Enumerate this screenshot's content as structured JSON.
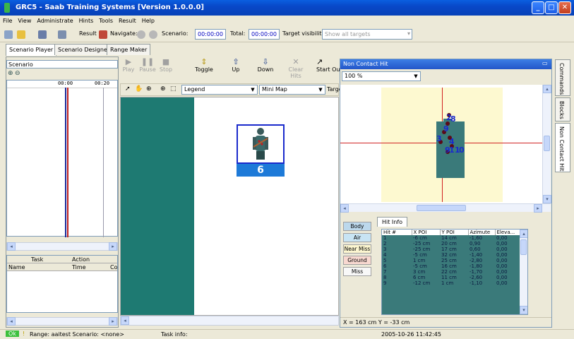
{
  "window": {
    "title": "GRC5 - Saab Training Systems  [Version 1.0.0.0]"
  },
  "menu": [
    "File",
    "View",
    "Administrate",
    "Hints",
    "Tools",
    "Result",
    "Help"
  ],
  "toolbar": {
    "result_label": "Result",
    "navigate_label": "Navigate:",
    "scenario_label": "Scenario:",
    "scenario_time": "00:00:00",
    "total_label": "Total:",
    "total_time": "00:00:00",
    "target_visibility_label": "Target visibility",
    "target_visibility_value": "Show all targets"
  },
  "tabs": [
    "Scenario Player",
    "Scenario Designer",
    "Range Maker"
  ],
  "left_panel": {
    "title": "Scenario",
    "time_start": "00:00",
    "time_end": "00:20",
    "task_columns": [
      "Task",
      "Action"
    ],
    "list_columns": [
      "Name",
      "Time",
      "Co"
    ]
  },
  "controls": {
    "play": "Play",
    "pause": "Pause",
    "stop": "Stop",
    "toggle": "Toggle",
    "up": "Up",
    "down": "Down",
    "clear_hits": "Clear Hits",
    "start_out": "Start Ou"
  },
  "view_toolbar": {
    "legend": "Legend",
    "minimap": "Mini Map",
    "target": "Targe"
  },
  "target": {
    "number": "6"
  },
  "non_contact": {
    "title": "Non Contact Hit",
    "zoom": "100 %",
    "hit_labels": [
      "2",
      "8",
      "3",
      "9",
      "1",
      "4",
      "9",
      "1",
      "0"
    ],
    "coords": "X = 163 cm   Y = -33 cm"
  },
  "hit_info": {
    "tab": "Hit Info",
    "categories": [
      "Body",
      "Air",
      "Near Miss",
      "Ground",
      "Miss"
    ],
    "columns": [
      "Hit #",
      "X POI",
      "Y POI",
      "Azimute",
      "Eleva..."
    ],
    "rows": [
      [
        "1",
        "-6 cm",
        "14 cm",
        "-1,60",
        "0,00"
      ],
      [
        "2",
        "-25 cm",
        "20 cm",
        "0,90",
        "0,00"
      ],
      [
        "3",
        "-25 cm",
        "17 cm",
        "0,60",
        "0,00"
      ],
      [
        "4",
        "-5 cm",
        "32 cm",
        "-1,40",
        "0,00"
      ],
      [
        "5",
        "1 cm",
        "25 cm",
        "-2,80",
        "0,00"
      ],
      [
        "6",
        "-5 cm",
        "16 cm",
        "-1,80",
        "0,00"
      ],
      [
        "7",
        "3 cm",
        "22 cm",
        "-1,70",
        "0,00"
      ],
      [
        "8",
        "6 cm",
        "11 cm",
        "-2,60",
        "0,00"
      ],
      [
        "9",
        "-12 cm",
        "1 cm",
        "-1,10",
        "0,00"
      ]
    ]
  },
  "side_tabs": [
    "Commands",
    "Blocks",
    "Non Contact Hit"
  ],
  "status": {
    "ok": "Ok",
    "range": "Range: aaitest  Scenario: <none>",
    "task_info": "Task info:",
    "datetime": "2005-10-26 11:42:45"
  }
}
